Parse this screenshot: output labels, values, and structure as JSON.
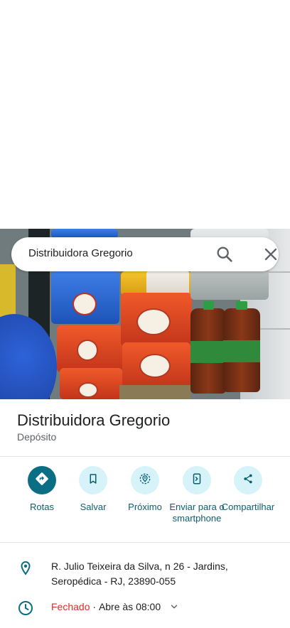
{
  "search": {
    "query": "Distribuidora Gregorio"
  },
  "icons": {
    "search": "search-icon",
    "close": "close-icon",
    "directions": "directions-icon",
    "save": "bookmark-icon",
    "nearby": "nearby-icon",
    "send": "send-to-phone-icon",
    "share": "share-icon",
    "location": "location-pin-icon",
    "clock": "clock-icon",
    "expand": "chevron-down-icon"
  },
  "place": {
    "name": "Distribuidora Gregorio",
    "category": "Depósito",
    "address": "R. Julio Teixeira da Silva, n 26 - Jardins, Seropédica - RJ, 23890-055",
    "status": "Fechado",
    "separator": " · ",
    "opens": "Abre às 08:00"
  },
  "actions": [
    {
      "label": "Rotas"
    },
    {
      "label": "Salvar"
    },
    {
      "label": "Próximo"
    },
    {
      "label": "Enviar para o smartphone"
    },
    {
      "label": "Compartilhar"
    }
  ],
  "colors": {
    "accent": "#0b6e84",
    "accent_light": "#d6f3fa",
    "closed": "#d93025",
    "text": "#202124",
    "secondary": "#5f6368"
  }
}
